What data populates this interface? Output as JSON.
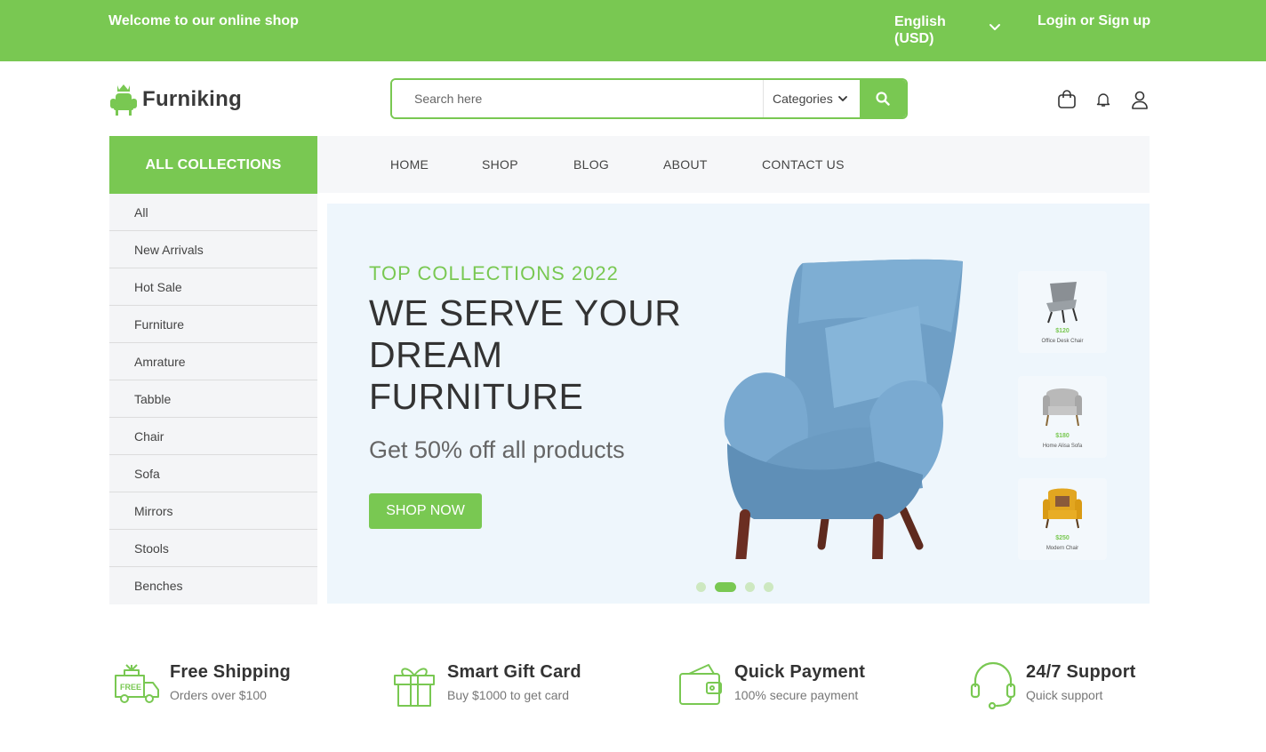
{
  "topbar": {
    "welcome": "Welcome to our online shop",
    "language": "English (USD)",
    "login": "Login or Sign up"
  },
  "brand": {
    "name": "Furniking",
    "accent_color": "#79c852"
  },
  "search": {
    "placeholder": "Search here",
    "category_label": "Categories"
  },
  "header_icons": [
    "shopping-bag-icon",
    "bell-icon",
    "user-icon"
  ],
  "sidebar": {
    "title": "ALL COLLECTIONS",
    "items": [
      "All",
      "New Arrivals",
      "Hot Sale",
      "Furniture",
      "Amrature",
      "Tabble",
      "Chair",
      "Sofa",
      "Mirrors",
      "Stools",
      "Benches"
    ]
  },
  "nav": {
    "items": [
      "HOME",
      "SHOP",
      "BLOG",
      "ABOUT",
      "CONTACT US"
    ]
  },
  "hero": {
    "tag": "TOP COLLECTIONS 2022",
    "title": "WE SERVE YOUR DREAM FURNITURE",
    "subtitle": "Get 50% off all products",
    "button": "SHOP NOW",
    "thumbnails": [
      {
        "price": "$120",
        "name": "Office Desk Chair"
      },
      {
        "price": "$180",
        "name": "Home Alisa Sofa"
      },
      {
        "price": "$250",
        "name": "Modern Chair"
      }
    ],
    "slides_total": 4,
    "active_slide": 2
  },
  "features": [
    {
      "icon": "free-delivery-truck-icon",
      "title": "Free Shipping",
      "subtitle": "Orders over $100"
    },
    {
      "icon": "gift-box-icon",
      "title": "Smart Gift Card",
      "subtitle": "Buy $1000 to get card"
    },
    {
      "icon": "wallet-icon",
      "title": "Quick Payment",
      "subtitle": "100% secure payment"
    },
    {
      "icon": "headset-support-icon",
      "title": "24/7 Support",
      "subtitle": "Quick support"
    }
  ]
}
